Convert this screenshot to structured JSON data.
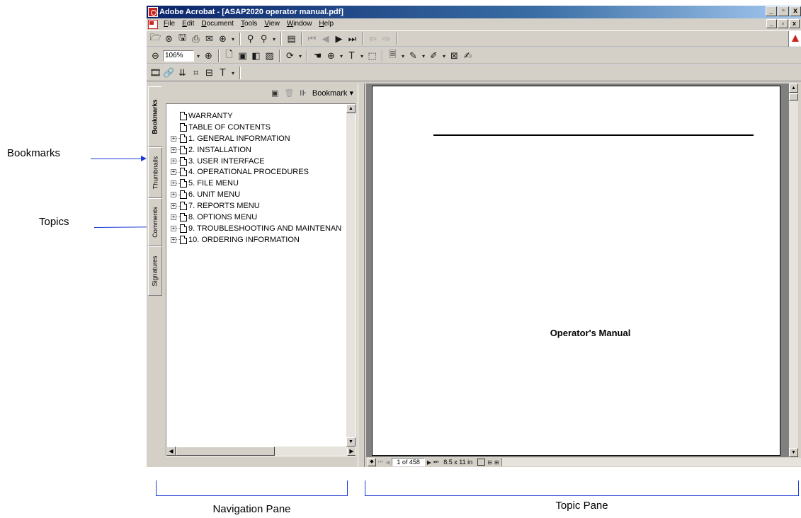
{
  "callouts": {
    "bookmarks": "Bookmarks",
    "topics": "Topics",
    "navigation_pane": "Navigation Pane",
    "topic_pane": "Topic Pane"
  },
  "window": {
    "title": "Adobe Acrobat - [ASAP2020 operator manual.pdf]",
    "controls": [
      "_",
      "▫",
      "x"
    ]
  },
  "menu": [
    {
      "label": "File",
      "ul": "F",
      "rest": "ile"
    },
    {
      "label": "Edit",
      "ul": "E",
      "rest": "dit"
    },
    {
      "label": "Document",
      "ul": "D",
      "rest": "ocument"
    },
    {
      "label": "Tools",
      "ul": "T",
      "rest": "ools"
    },
    {
      "label": "View",
      "ul": "V",
      "rest": "iew"
    },
    {
      "label": "Window",
      "ul": "W",
      "rest": "indow"
    },
    {
      "label": "Help",
      "ul": "H",
      "rest": "elp"
    }
  ],
  "toolbar": {
    "zoom_value": "106%"
  },
  "tabs": [
    "Bookmarks",
    "Thumbnails",
    "Comments",
    "Signatures"
  ],
  "nav": {
    "menu_label": "Bookmark ▾",
    "bookmarks": [
      {
        "label": "WARRANTY",
        "expandable": false
      },
      {
        "label": "TABLE OF CONTENTS",
        "expandable": false
      },
      {
        "label": "1. GENERAL INFORMATION",
        "expandable": true
      },
      {
        "label": "2. INSTALLATION",
        "expandable": true
      },
      {
        "label": "3. USER INTERFACE",
        "expandable": true
      },
      {
        "label": "4. OPERATIONAL PROCEDURES",
        "expandable": true
      },
      {
        "label": "5. FILE MENU",
        "expandable": true
      },
      {
        "label": "6. UNIT MENU",
        "expandable": true
      },
      {
        "label": "7. REPORTS MENU",
        "expandable": true
      },
      {
        "label": "8. OPTIONS MENU",
        "expandable": true
      },
      {
        "label": "9. TROUBLESHOOTING AND MAINTENAN",
        "expandable": true
      },
      {
        "label": "10. ORDERING INFORMATION",
        "expandable": true
      }
    ]
  },
  "document": {
    "page_heading": "Operator's Manual"
  },
  "status": {
    "page_indicator": "1 of 458",
    "page_size": "8.5 x 11 in"
  },
  "colors": {
    "callout_blue": "#1d3bd6",
    "window_bg": "#d4d0c8",
    "titlebar": "#0a246a"
  }
}
